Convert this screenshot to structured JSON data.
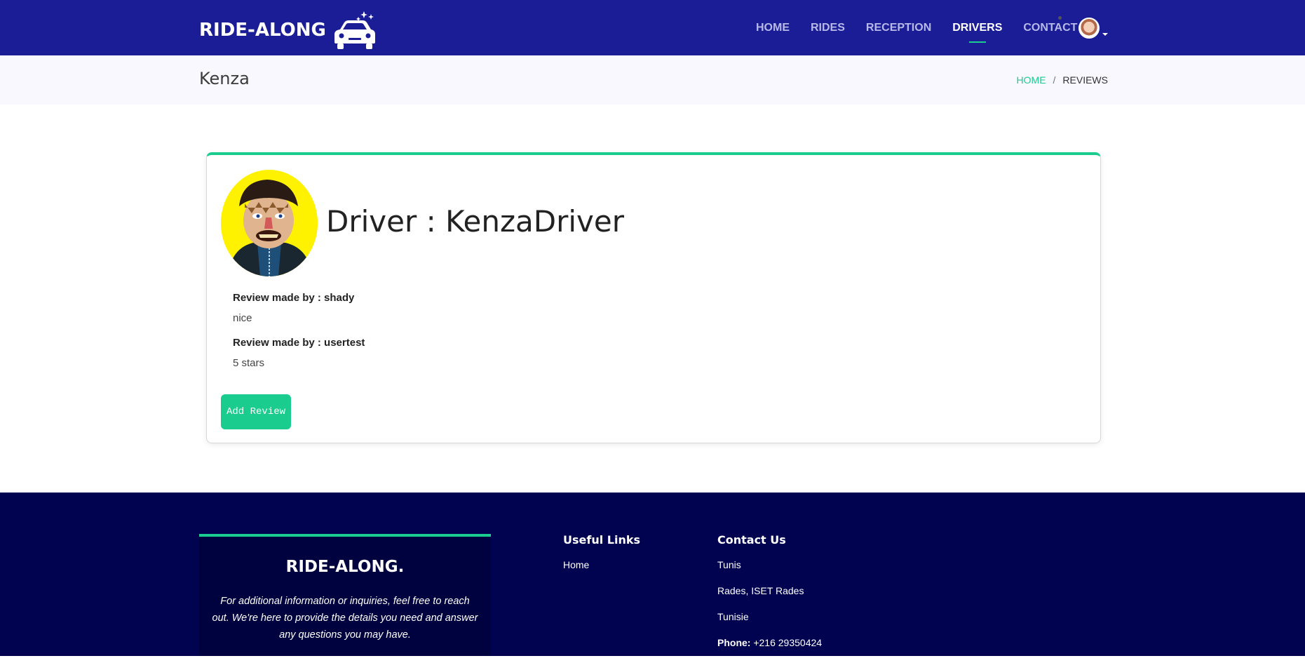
{
  "header": {
    "logo_text": "RIDE-ALONG",
    "nav": [
      {
        "label": "HOME"
      },
      {
        "label": "RIDES"
      },
      {
        "label": "RECEPTION"
      },
      {
        "label": "DRIVERS",
        "active": true
      },
      {
        "label": "CONTACT"
      }
    ]
  },
  "crumbbar": {
    "title": "Kenza",
    "home": "HOME",
    "separator": "/",
    "current": "REVIEWS"
  },
  "card": {
    "heading": "Driver : KenzaDriver",
    "reviews": [
      {
        "author": "Review made by : shady",
        "text": "nice"
      },
      {
        "author": "Review made by : usertest",
        "text": "5 stars"
      }
    ],
    "add_button": "Add Review"
  },
  "footer": {
    "brand_title": "RIDE-ALONG.",
    "brand_text": "For additional information or inquiries, feel free to reach out. We're here to provide the details you need and answer any questions you may have.",
    "useful_links_title": "Useful Links",
    "useful_links": [
      "Home"
    ],
    "contact_title": "Contact Us",
    "contact_lines": [
      "Tunis",
      "Rades, ISET Rades",
      "Tunisie"
    ],
    "phone_label": "Phone:",
    "phone_value": "+216 29350424"
  },
  "colors": {
    "header_bg": "#1b1d96",
    "accent": "#1acc8d",
    "footer_bg": "#010350"
  }
}
